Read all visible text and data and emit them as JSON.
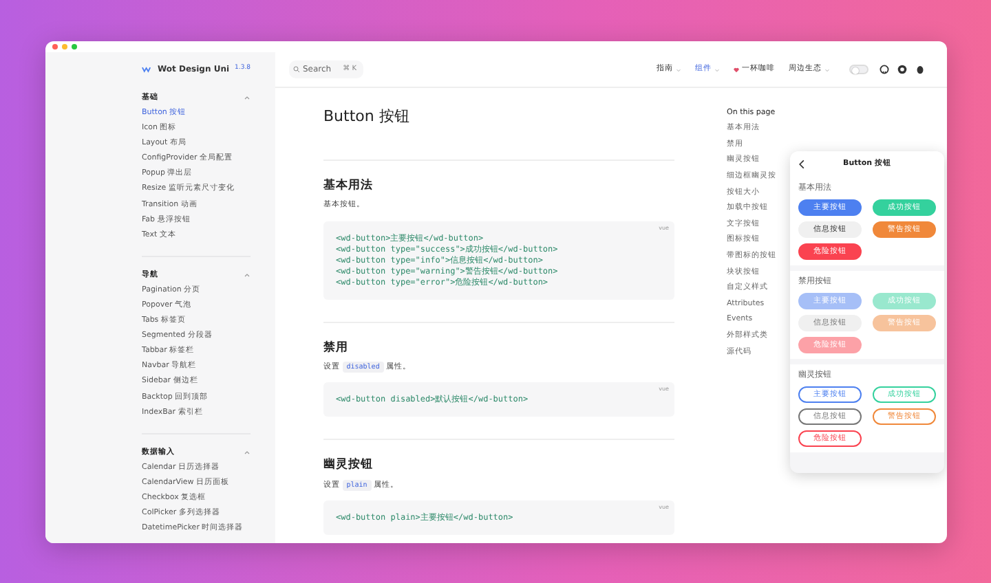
{
  "brand": {
    "name": "Wot Design Uni",
    "version": "1.3.8"
  },
  "sidebar": {
    "groups": [
      {
        "title": "基础",
        "expanded": true,
        "items": [
          {
            "label": "Button 按钮",
            "selected": true
          },
          {
            "label": "Icon 图标",
            "selected": false
          },
          {
            "label": "Layout 布局",
            "selected": false
          },
          {
            "label": "ConfigProvider 全局配置",
            "selected": false
          },
          {
            "label": "Popup 弹出层",
            "selected": false
          },
          {
            "label": "Resize 监听元素尺寸变化",
            "selected": false
          },
          {
            "label": "Transition 动画",
            "selected": false
          },
          {
            "label": "Fab 悬浮按钮",
            "selected": false
          },
          {
            "label": "Text 文本",
            "selected": false
          }
        ]
      },
      {
        "title": "导航",
        "expanded": true,
        "items": [
          {
            "label": "Pagination 分页",
            "selected": false
          },
          {
            "label": "Popover 气泡",
            "selected": false
          },
          {
            "label": "Tabs 标签页",
            "selected": false
          },
          {
            "label": "Segmented 分段器",
            "selected": false
          },
          {
            "label": "Tabbar 标签栏",
            "selected": false
          },
          {
            "label": "Navbar 导航栏",
            "selected": false
          },
          {
            "label": "Sidebar 侧边栏",
            "selected": false
          },
          {
            "label": "Backtop 回到顶部",
            "selected": false
          },
          {
            "label": "IndexBar 索引栏",
            "selected": false
          }
        ]
      },
      {
        "title": "数据输入",
        "expanded": true,
        "items": [
          {
            "label": "Calendar 日历选择器",
            "selected": false
          },
          {
            "label": "CalendarView 日历面板",
            "selected": false
          },
          {
            "label": "Checkbox 复选框",
            "selected": false
          },
          {
            "label": "ColPicker 多列选择器",
            "selected": false
          },
          {
            "label": "DatetimePicker 时间选择器",
            "selected": false
          }
        ]
      }
    ]
  },
  "header": {
    "search": {
      "placeholder": "Search",
      "shortcut": "⌘ K"
    },
    "nav": [
      {
        "label": "指南",
        "kind": "dropdown",
        "selected": false
      },
      {
        "label": "组件",
        "kind": "dropdown",
        "selected": true
      },
      {
        "label": "一杯咖啡",
        "kind": "heart",
        "selected": false
      },
      {
        "label": "周边生态",
        "kind": "dropdown",
        "selected": false
      }
    ],
    "dark_mode": false
  },
  "article": {
    "title": "Button 按钮",
    "sections": [
      {
        "heading": "基本用法",
        "text": "基本按钮。",
        "lang": "vue",
        "code": [
          "<wd-button>主要按钮</wd-button>",
          "<wd-button type=\"success\">成功按钮</wd-button>",
          "<wd-button type=\"info\">信息按钮</wd-button>",
          "<wd-button type=\"warning\">警告按钮</wd-button>",
          "<wd-button type=\"error\">危险按钮</wd-button>"
        ]
      },
      {
        "heading": "禁用",
        "text_before": "设置",
        "attr": "disabled",
        "text_after": "属性。",
        "lang": "vue",
        "code": [
          "<wd-button disabled>默认按钮</wd-button>"
        ]
      },
      {
        "heading": "幽灵按钮",
        "text_before": "设置",
        "attr": "plain",
        "text_after": "属性。",
        "lang": "vue",
        "code": [
          "<wd-button plain>主要按钮</wd-button>"
        ]
      }
    ]
  },
  "toc": {
    "title": "On this page",
    "items": [
      {
        "label": "基本用法",
        "selected": false
      },
      {
        "label": "禁用",
        "selected": false
      },
      {
        "label": "幽灵按钮",
        "selected": false
      },
      {
        "label": "细边框幽灵按",
        "selected": false
      },
      {
        "label": "按钮大小",
        "selected": false
      },
      {
        "label": "加载中按钮",
        "selected": false
      },
      {
        "label": "文字按钮",
        "selected": false
      },
      {
        "label": "图标按钮",
        "selected": false
      },
      {
        "label": "带图标的按钮",
        "selected": false
      },
      {
        "label": "块状按钮",
        "selected": false
      },
      {
        "label": "自定义样式",
        "selected": false
      },
      {
        "label": "Attributes",
        "selected": false
      },
      {
        "label": "Events",
        "selected": false
      },
      {
        "label": "外部样式类",
        "selected": false
      },
      {
        "label": "源代码",
        "selected": false
      }
    ]
  },
  "phone": {
    "title": "Button 按钮",
    "sections": [
      {
        "title": "基本用法",
        "kind": "normal",
        "buttons": [
          {
            "label": "主要按钮",
            "color": "#4d80f0"
          },
          {
            "label": "成功按钮",
            "color": "#34d19d"
          },
          {
            "label": "信息按钮",
            "color": "#f0f0f0"
          },
          {
            "label": "警告按钮",
            "color": "#f0883a"
          },
          {
            "label": "危险按钮",
            "color": "#fa4350"
          }
        ]
      },
      {
        "title": "禁用按钮",
        "kind": "disabled",
        "buttons": [
          {
            "label": "主要按钮",
            "color": "#a6bff7"
          },
          {
            "label": "成功按钮",
            "color": "#99e8ce"
          },
          {
            "label": "信息按钮",
            "color": "#f0f0f0"
          },
          {
            "label": "警告按钮",
            "color": "#f7c39c"
          },
          {
            "label": "危险按钮",
            "color": "#fca1a7"
          }
        ]
      },
      {
        "title": "幽灵按钮",
        "kind": "plain",
        "buttons": [
          {
            "label": "主要按钮",
            "color": "#4d80f0"
          },
          {
            "label": "成功按钮",
            "color": "#34d19d"
          },
          {
            "label": "信息按钮",
            "color": "#777777"
          },
          {
            "label": "警告按钮",
            "color": "#f0883a"
          },
          {
            "label": "危险按钮",
            "color": "#fa4350"
          }
        ]
      }
    ]
  }
}
